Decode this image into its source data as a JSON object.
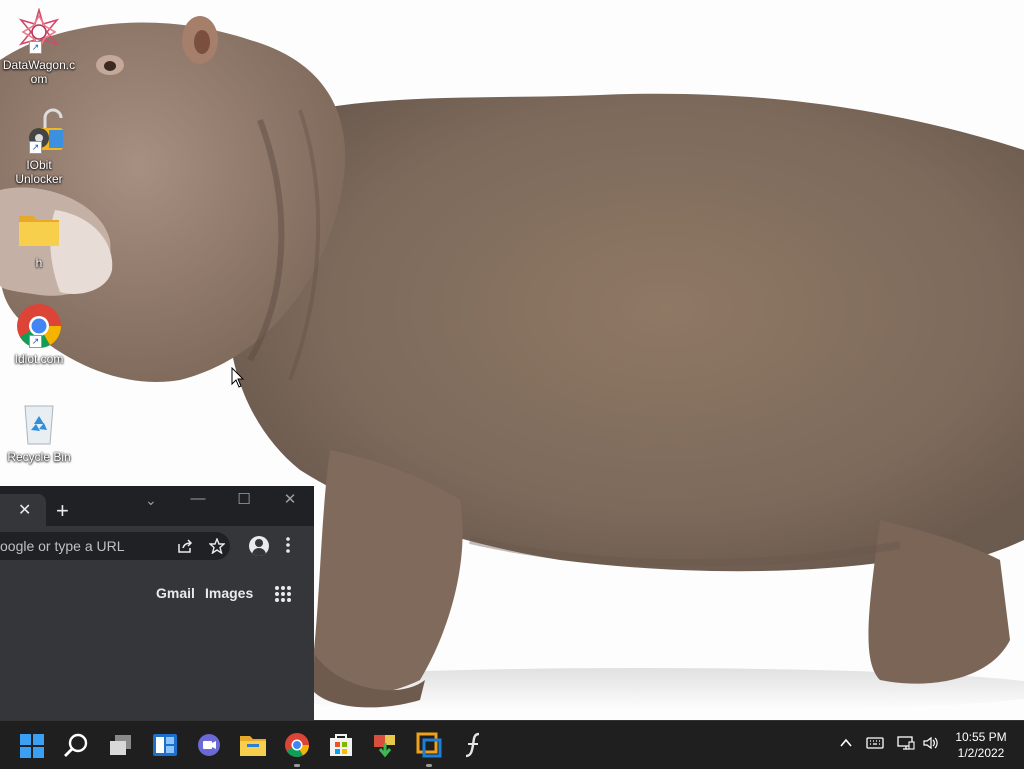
{
  "desktop": {
    "icons": [
      {
        "label": "DataWagon.com",
        "icon": "datawagon-icon"
      },
      {
        "label": "IObit Unlocker",
        "icon": "iobit-unlocker-icon"
      },
      {
        "label": "h",
        "icon": "folder-icon"
      },
      {
        "label": "Idiot.com",
        "icon": "chrome-icon"
      },
      {
        "label": "Recycle Bin",
        "icon": "recycle-bin-icon"
      }
    ]
  },
  "chrome": {
    "tab_close": "✕",
    "new_tab": "+",
    "omnibox_placeholder": "oogle or type a URL",
    "links": {
      "gmail": "Gmail",
      "images": "Images"
    },
    "window_controls": {
      "minimize": "—",
      "maximize": "☐",
      "close": "✕",
      "tab_search": "⌄"
    }
  },
  "taskbar": {
    "apps": [
      "start-icon",
      "search-icon",
      "task-view-icon",
      "widgets-icon",
      "teams-chat-icon",
      "file-explorer-icon",
      "chrome-icon",
      "microsoft-store-icon",
      "app-installer-icon",
      "virtualbox-icon",
      "script-app-icon"
    ],
    "tray": [
      "chevron-up-icon",
      "keyboard-icon",
      "network-icon",
      "volume-icon"
    ],
    "clock": {
      "time": "10:55 PM",
      "date": "1/2/2022"
    }
  },
  "colors": {
    "taskbar_bg": "#1f1f1f",
    "chrome_dark": "#202124",
    "chrome_surface": "#35363a",
    "folder_yellow": "#f5c542",
    "windows_blue": "#2b9af3"
  }
}
